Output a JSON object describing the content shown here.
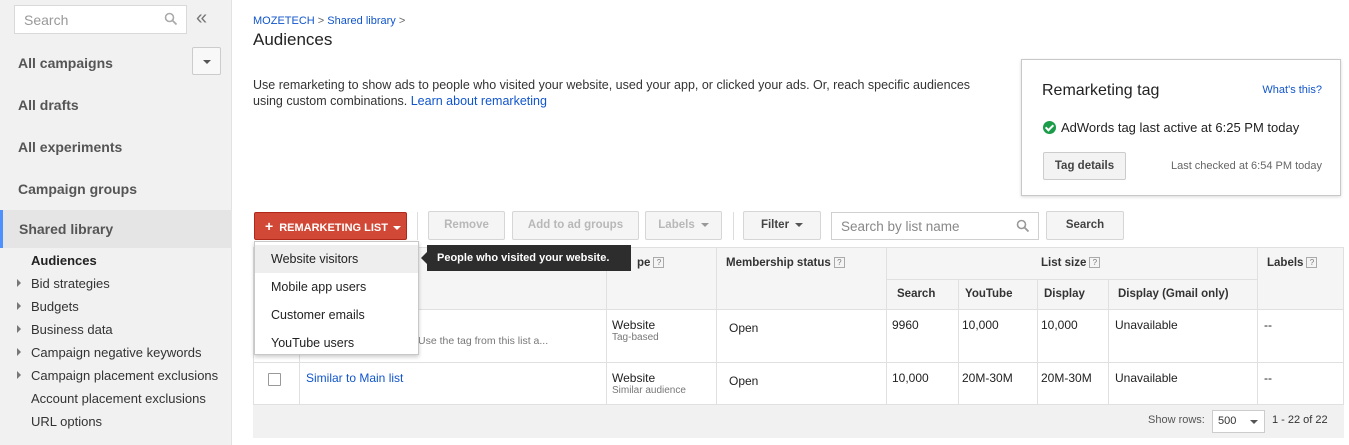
{
  "sidebar": {
    "search_placeholder": "Search",
    "collapse_glyph": "«",
    "links": [
      "All campaigns",
      "All drafts",
      "All experiments",
      "Campaign groups"
    ],
    "shared_library": "Shared library",
    "sub_items": [
      {
        "label": "Audiences",
        "active": true,
        "expandable": false
      },
      {
        "label": "Bid strategies",
        "expandable": true
      },
      {
        "label": "Budgets",
        "expandable": true
      },
      {
        "label": "Business data",
        "expandable": true
      },
      {
        "label": "Campaign negative keywords",
        "expandable": true
      },
      {
        "label": "Campaign placement exclusions",
        "expandable": true
      },
      {
        "label": "Account placement exclusions",
        "expandable": false
      },
      {
        "label": "URL options",
        "expandable": false
      }
    ]
  },
  "header": {
    "breadcrumb": [
      "MOZETECH",
      "Shared library"
    ],
    "breadcrumb_sep": ">",
    "title": "Audiences",
    "intro": "Use remarketing to show ads to people who visited your website, used your app, or clicked your ads. Or, reach specific audiences using custom combinations.",
    "intro_link": "Learn about remarketing"
  },
  "remarketing_tag": {
    "title": "Remarketing tag",
    "whats_this": "What's this?",
    "status": "AdWords tag last active at 6:25 PM today",
    "details_button": "Tag details",
    "last_checked": "Last checked at 6:54 PM today"
  },
  "toolbar": {
    "remarketing_list": "REMARKETING LIST",
    "plus": "+",
    "remove": "Remove",
    "add_to_ad_groups": "Add to ad groups",
    "labels": "Labels",
    "filter": "Filter",
    "search_placeholder": "Search by list name",
    "search": "Search"
  },
  "menu": {
    "items": [
      "Website visitors",
      "Mobile app users",
      "Customer emails",
      "YouTube users"
    ],
    "tooltip": "People who visited your website."
  },
  "table": {
    "headers": {
      "type": "pe",
      "membership": "Membership status",
      "list_size": "List size",
      "labels": "Labels",
      "search": "Search",
      "youtube": "YouTube",
      "display": "Display",
      "gmail": "Display (Gmail only)"
    },
    "qmark": "?",
    "rows": [
      {
        "name": "",
        "desc": "Use the tag from this list a...",
        "type": "Website",
        "subtype": "Tag-based",
        "membership": "Open",
        "search": "9960",
        "youtube": "10,000",
        "display": "10,000",
        "gmail": "Unavailable",
        "labels": "--"
      },
      {
        "name": "Similar to Main list",
        "type": "Website",
        "subtype": "Similar audience",
        "membership": "Open",
        "search": "10,000",
        "youtube": "20M-30M",
        "display": "20M-30M",
        "gmail": "Unavailable",
        "labels": "--"
      }
    ]
  },
  "footer": {
    "show_rows": "Show rows:",
    "rows_value": "500",
    "range": "1 - 22 of 22"
  },
  "colors": {
    "accent": "#d14836",
    "link": "#1155cc",
    "success": "#1a9c49",
    "sidebar_active": "#4d90fe"
  }
}
